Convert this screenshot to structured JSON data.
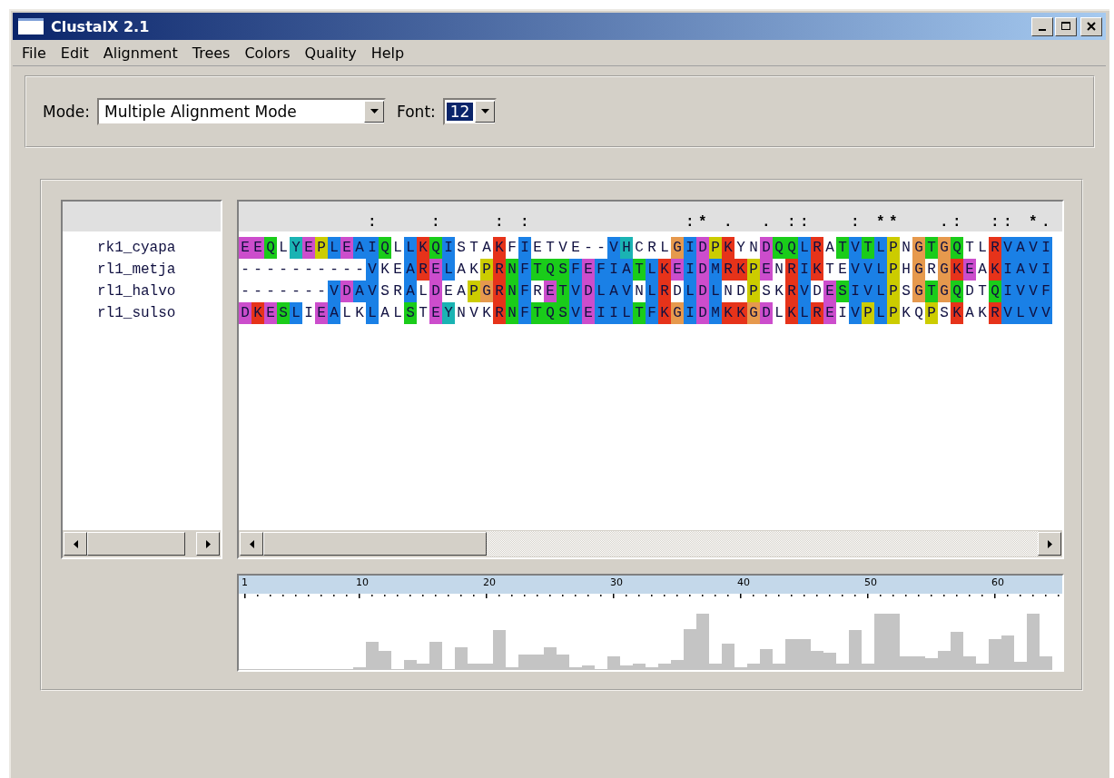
{
  "window": {
    "title": "ClustalX 2.1"
  },
  "menu": [
    {
      "label": "File"
    },
    {
      "label": "Edit"
    },
    {
      "label": "Alignment"
    },
    {
      "label": "Trees"
    },
    {
      "label": "Colors"
    },
    {
      "label": "Quality"
    },
    {
      "label": "Help"
    }
  ],
  "toolbar": {
    "mode_label": "Mode:",
    "mode": "Multiple Alignment Mode",
    "font_label": "Font:",
    "font": {
      "value": "12",
      "selected": true
    }
  },
  "alignment": {
    "conservation": "          :    :    : :            :* .  . ::   : **   .:  :: *.",
    "sequences": [
      {
        "name": "rk1_cyapa",
        "residues": "EEQLYEPLEAIQLLKQISTAKFIETVE--VHCRLGIDPKYNDQQLRATVTLPNGTGQTLRVAVI"
      },
      {
        "name": "rl1_metja",
        "residues": "----------VKEARELAKPRNFTQSFEFIATLKEIDMRKPENRIKTEVVLPHGRGKEAKIAVI"
      },
      {
        "name": "rl1_halvo",
        "residues": "-------VDAVSRALDEAPGRNFRETVDLAVNLRDLDLNDPSKRVDESIVLPSGTGQDTQIVVF"
      },
      {
        "name": "rl1_sulso",
        "residues": "DKESLIEALKLALSTEYNVKRNFTQSVEIILTFKGIDMKKGDLKLREIVPLPKQPSKAKRVLVV"
      }
    ]
  },
  "quality_ruler": {
    "labels": [
      "1",
      "10",
      "20",
      "30",
      "40",
      "50",
      "60"
    ]
  }
}
